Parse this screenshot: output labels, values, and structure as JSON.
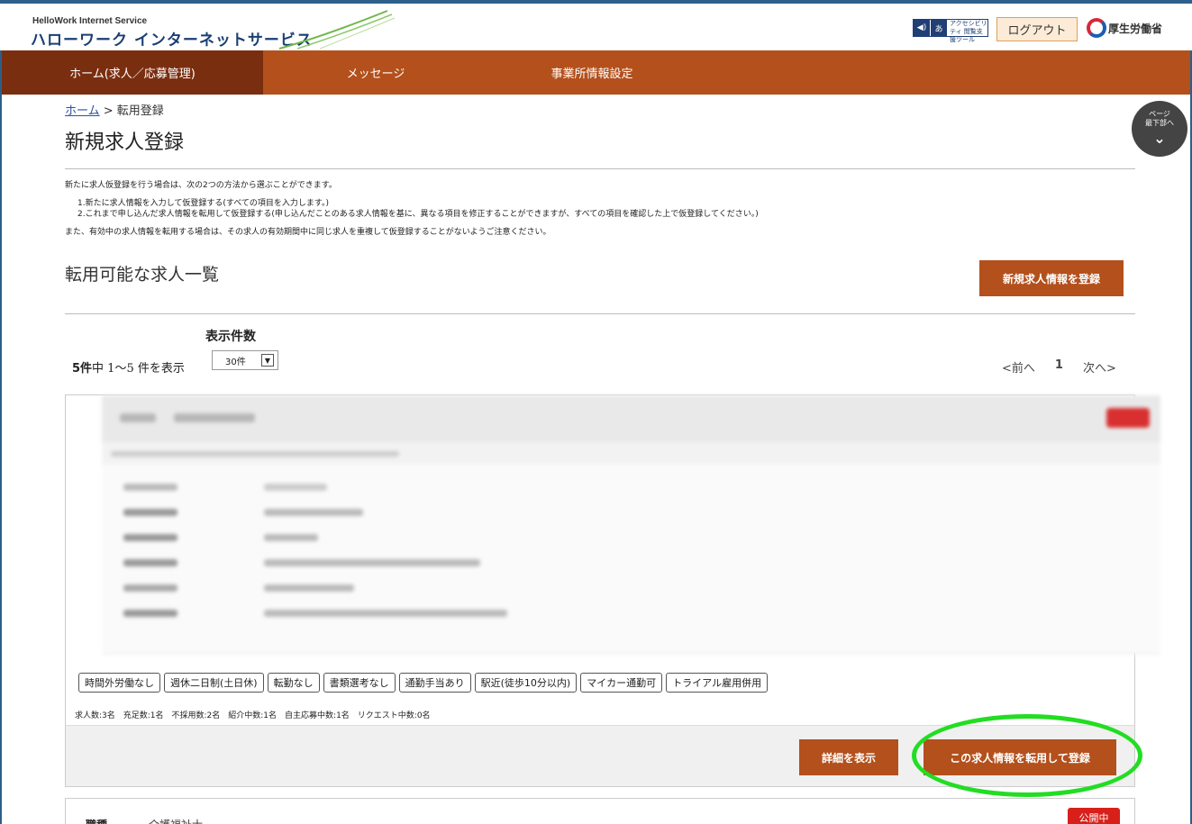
{
  "header": {
    "logo_small": "HelloWork Internet Service",
    "logo_main": "ハローワーク インターネットサービス",
    "a11y_label": "アクセシビリティ 閲覧支援ツール",
    "logout_label": "ログアウト",
    "ministry_label": "厚生労働省"
  },
  "nav": {
    "items": [
      {
        "label": "ホーム(求人／応募管理)"
      },
      {
        "label": "メッセージ"
      },
      {
        "label": "事業所情報設定"
      }
    ]
  },
  "jump": {
    "line1": "ページ",
    "line2": "最下部へ"
  },
  "breadcrumb": {
    "home": "ホーム",
    "current": " > 転用登録"
  },
  "page_title": "新規求人登録",
  "intro": {
    "line1": "新たに求人仮登録を行う場合は、次の2つの方法から選ぶことができます。",
    "line2": "1.新たに求人情報を入力して仮登録する(すべての項目を入力します。)",
    "line3": "2.これまで申し込んだ求人情報を転用して仮登録する(申し込んだことのある求人情報を基に、異なる項目を修正することができますが、すべての項目を確認した上で仮登録してください。)",
    "line4": "また、有効中の求人情報を転用する場合は、その求人の有効期間中に同じ求人を重複して仮登録することがないようご注意ください。"
  },
  "section": {
    "title": "転用可能な求人一覧",
    "new_button": "新規求人情報を登録"
  },
  "listing": {
    "per_page_label": "表示件数",
    "count_bold": "5件",
    "count_rest": "中 1〜5 件を表示",
    "per_page_value": "30件",
    "pager": {
      "prev": "<前へ",
      "page": "1",
      "next": "次へ>"
    }
  },
  "card": {
    "tags": [
      "時間外労働なし",
      "週休二日制(土日休)",
      "転勤なし",
      "書類選考なし",
      "通勤手当あり",
      "駅近(徒歩10分以内)",
      "マイカー通勤可",
      "トライアル雇用併用"
    ],
    "stats": "求人数:3名　充足数:1名　不採用数:2名　紹介中数:1名　自主応募中数:1名　リクエスト中数:0名",
    "detail_button": "詳細を表示",
    "reuse_button": "この求人情報を転用して登録"
  },
  "card2": {
    "title": "職種",
    "subtitle": "介護福祉士",
    "badge": "公開中"
  },
  "colors": {
    "nav": "#b3501c",
    "nav_active": "#7a2e10",
    "button": "#b3501c",
    "highlight": "#22dd22"
  }
}
